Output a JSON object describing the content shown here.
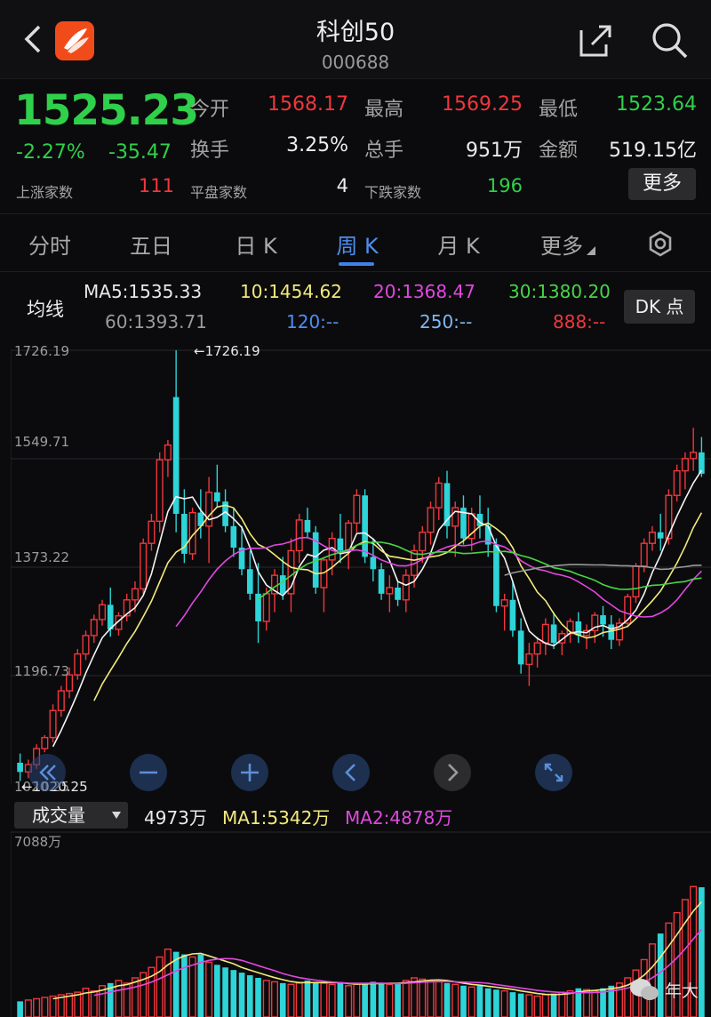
{
  "header": {
    "title": "科创50",
    "code": "000688",
    "back_icon": "chevron-left-icon",
    "share_icon": "share-icon",
    "search_icon": "search-icon"
  },
  "quote": {
    "price": "1525.23",
    "change_pct": "-2.27%",
    "change_amt": "-35.47",
    "open_label": "今开",
    "open": "1568.17",
    "high_label": "最高",
    "high": "1569.25",
    "low_label": "最低",
    "low": "1523.64",
    "turnover_label": "换手",
    "turnover": "3.25%",
    "volume_label": "总手",
    "volume": "951万",
    "amount_label": "金额",
    "amount": "519.15亿",
    "up_label": "上涨家数",
    "up": "111",
    "flat_label": "平盘家数",
    "flat": "4",
    "down_label": "下跌家数",
    "down": "196",
    "more": "更多"
  },
  "tabs": [
    {
      "label": "分时"
    },
    {
      "label": "五日"
    },
    {
      "label": "日 K"
    },
    {
      "label": "周 K",
      "active": true
    },
    {
      "label": "月 K"
    },
    {
      "label": "更多"
    }
  ],
  "ma": {
    "title": "均线",
    "ma5": "MA5:1535.33",
    "ma10": "10:1454.62",
    "ma20": "20:1368.47",
    "ma30": "30:1380.20",
    "ma60": "60:1393.71",
    "ma120": "120:--",
    "ma250": "250:--",
    "ma888": "888:--",
    "dk": "DK 点"
  },
  "colors": {
    "up": "#f0373c",
    "down": "#2dd4d8",
    "ma5": "#f4f4f4",
    "ma10": "#f2ea7c",
    "ma20": "#e048e0",
    "ma30": "#49d448",
    "ma60": "#9a9a9a",
    "ma120": "#4d8ff0",
    "ma250": "#7fb8f0"
  },
  "chart_data": [
    {
      "type": "candlestick",
      "y_labels": [
        "1726.19",
        "1549.71",
        "1373.22",
        "1196.73",
        "1020.25"
      ],
      "ylim": [
        1020.25,
        1726.19
      ],
      "max_marker": "1726.19",
      "min_marker": "1020.25",
      "grid": true,
      "candles": [
        [
          1055,
          1070,
          1025,
          1040
        ],
        [
          1040,
          1060,
          1030,
          1052
        ],
        [
          1052,
          1085,
          1045,
          1078
        ],
        [
          1078,
          1100,
          1072,
          1096
        ],
        [
          1096,
          1150,
          1088,
          1140
        ],
        [
          1140,
          1180,
          1130,
          1172
        ],
        [
          1172,
          1210,
          1160,
          1198
        ],
        [
          1198,
          1240,
          1190,
          1232
        ],
        [
          1232,
          1270,
          1222,
          1262
        ],
        [
          1262,
          1296,
          1250,
          1288
        ],
        [
          1288,
          1320,
          1278,
          1312
        ],
        [
          1312,
          1340,
          1260,
          1272
        ],
        [
          1272,
          1300,
          1262,
          1294
        ],
        [
          1294,
          1330,
          1285,
          1320
        ],
        [
          1320,
          1350,
          1300,
          1338
        ],
        [
          1338,
          1420,
          1330,
          1412
        ],
        [
          1412,
          1460,
          1400,
          1448
        ],
        [
          1448,
          1560,
          1430,
          1548
        ],
        [
          1548,
          1580,
          1520,
          1572
        ],
        [
          1650,
          1726.19,
          1430,
          1460
        ],
        [
          1460,
          1500,
          1380,
          1395
        ],
        [
          1395,
          1470,
          1385,
          1462
        ],
        [
          1462,
          1500,
          1420,
          1440
        ],
        [
          1440,
          1520,
          1380,
          1495
        ],
        [
          1495,
          1540,
          1470,
          1480
        ],
        [
          1480,
          1500,
          1430,
          1440
        ],
        [
          1440,
          1470,
          1390,
          1405
        ],
        [
          1405,
          1440,
          1360,
          1370
        ],
        [
          1370,
          1400,
          1320,
          1330
        ],
        [
          1330,
          1380,
          1250,
          1285
        ],
        [
          1285,
          1340,
          1270,
          1330
        ],
        [
          1330,
          1370,
          1300,
          1360
        ],
        [
          1360,
          1390,
          1320,
          1330
        ],
        [
          1330,
          1420,
          1300,
          1400
        ],
        [
          1400,
          1460,
          1380,
          1450
        ],
        [
          1450,
          1470,
          1420,
          1430
        ],
        [
          1430,
          1440,
          1330,
          1340
        ],
        [
          1340,
          1390,
          1300,
          1385
        ],
        [
          1385,
          1430,
          1360,
          1420
        ],
        [
          1420,
          1460,
          1380,
          1400
        ],
        [
          1400,
          1450,
          1370,
          1445
        ],
        [
          1445,
          1500,
          1430,
          1490
        ],
        [
          1490,
          1500,
          1380,
          1390
        ],
        [
          1390,
          1420,
          1350,
          1370
        ],
        [
          1370,
          1380,
          1320,
          1330
        ],
        [
          1330,
          1360,
          1300,
          1340
        ],
        [
          1340,
          1350,
          1310,
          1320
        ],
        [
          1320,
          1370,
          1300,
          1360
        ],
        [
          1360,
          1410,
          1340,
          1400
        ],
        [
          1400,
          1440,
          1380,
          1430
        ],
        [
          1430,
          1480,
          1410,
          1470
        ],
        [
          1470,
          1520,
          1450,
          1510
        ],
        [
          1510,
          1530,
          1420,
          1440
        ],
        [
          1440,
          1480,
          1390,
          1470
        ],
        [
          1470,
          1490,
          1410,
          1420
        ],
        [
          1420,
          1470,
          1400,
          1460
        ],
        [
          1460,
          1490,
          1420,
          1440
        ],
        [
          1440,
          1470,
          1390,
          1410
        ],
        [
          1410,
          1420,
          1300,
          1310
        ],
        [
          1310,
          1330,
          1270,
          1320
        ],
        [
          1320,
          1350,
          1260,
          1270
        ],
        [
          1270,
          1290,
          1200,
          1215
        ],
        [
          1215,
          1250,
          1180,
          1232
        ],
        [
          1232,
          1260,
          1210,
          1250
        ],
        [
          1250,
          1290,
          1230,
          1280
        ],
        [
          1280,
          1300,
          1240,
          1250
        ],
        [
          1250,
          1270,
          1230,
          1265
        ],
        [
          1265,
          1290,
          1250,
          1285
        ],
        [
          1285,
          1300,
          1250,
          1262
        ],
        [
          1262,
          1280,
          1240,
          1270
        ],
        [
          1270,
          1300,
          1250,
          1295
        ],
        [
          1295,
          1310,
          1260,
          1280
        ],
        [
          1280,
          1295,
          1240,
          1255
        ],
        [
          1255,
          1290,
          1245,
          1282
        ],
        [
          1282,
          1330,
          1275,
          1325
        ],
        [
          1325,
          1380,
          1315,
          1375
        ],
        [
          1375,
          1420,
          1365,
          1412
        ],
        [
          1412,
          1440,
          1400,
          1430
        ],
        [
          1430,
          1460,
          1400,
          1420
        ],
        [
          1420,
          1500,
          1410,
          1490
        ],
        [
          1490,
          1540,
          1480,
          1530
        ],
        [
          1530,
          1560,
          1500,
          1550
        ],
        [
          1550,
          1600,
          1530,
          1560
        ],
        [
          1560,
          1585,
          1520,
          1525.23
        ]
      ]
    },
    {
      "type": "bar",
      "title": "成交量",
      "current": "4973万",
      "ma1": "MA1:5342万",
      "ma2": "MA2:4878万",
      "y_max_label": "7088万",
      "ylim": [
        0,
        7088
      ],
      "values": [
        600,
        650,
        700,
        750,
        800,
        850,
        900,
        950,
        1100,
        1000,
        1200,
        1300,
        1400,
        1300,
        1500,
        1700,
        1900,
        2300,
        2600,
        2500,
        2400,
        2300,
        2400,
        2100,
        2000,
        1900,
        1800,
        1700,
        1600,
        1500,
        1400,
        1350,
        1300,
        1250,
        1300,
        1400,
        1350,
        1300,
        1250,
        1300,
        1200,
        1250,
        1300,
        1350,
        1300,
        1250,
        1300,
        1400,
        1500,
        1450,
        1400,
        1350,
        1300,
        1250,
        1200,
        1150,
        1200,
        1100,
        1050,
        1000,
        950,
        900,
        850,
        800,
        850,
        900,
        950,
        1000,
        1100,
        1050,
        1000,
        1100,
        1200,
        1300,
        1500,
        1800,
        2200,
        2800,
        3200,
        3600,
        4000,
        4500,
        5000,
        4973
      ]
    }
  ],
  "controls": {
    "zoom_out_icon": "minus-icon",
    "zoom_in_icon": "plus-icon",
    "prev_icon": "chevron-left-icon",
    "next_icon": "chevron-right-icon",
    "fullscreen_icon": "expand-icon"
  },
  "watermark": "年大"
}
